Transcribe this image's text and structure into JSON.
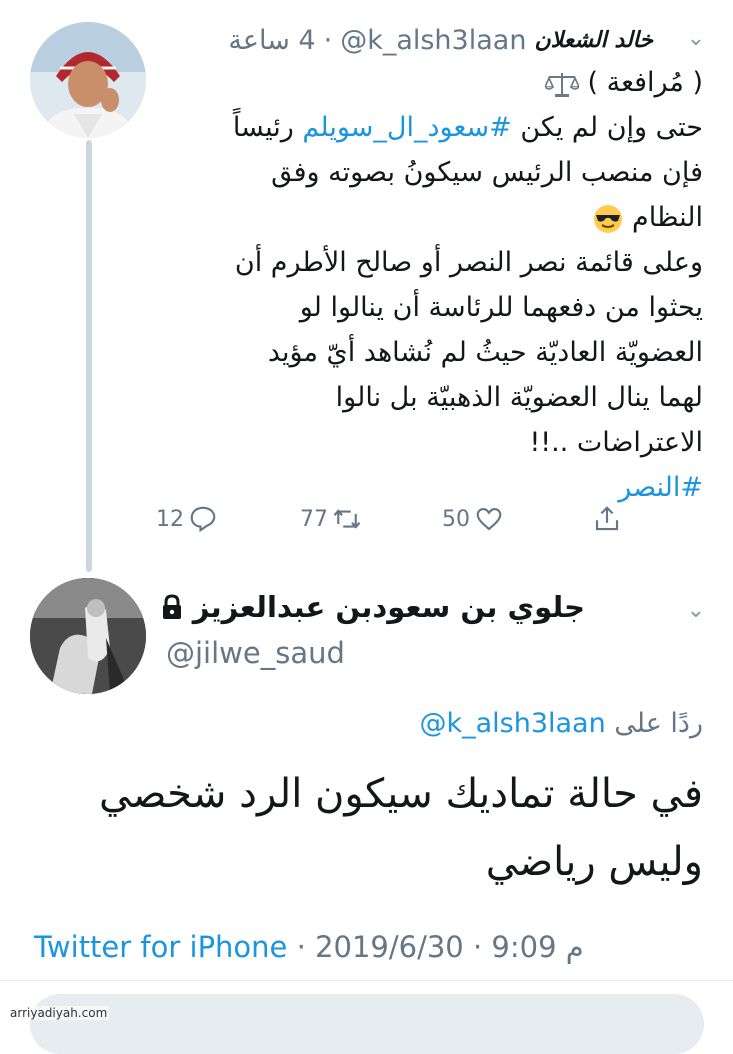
{
  "tweet1": {
    "author_name": "خالد الشعلان",
    "author_handle": "@k_alsh3laan",
    "time": "4 ساعة",
    "separator": "·",
    "body_lines": [
      "( مُرافعة )",
      "حتى وإن لم يكن #سعود_ال_سويلم رئيساً",
      "فإن منصب الرئيس سيكونُ بصوته وفق",
      "النظام",
      "وعلى قائمة نصر النصر أو صالح الأطرم أن",
      "يحثوا من دفعهما للرئاسة أن ينالوا لو",
      "العضويّة العاديّة حيثُ لم نُشاهد أيّ مؤيد",
      "لهما ينال العضويّة الذهبيّة بل نالوا",
      "الاعتراضات ..!!",
      "#النصر"
    ],
    "inline_prefix": "حتى وإن لم يكن ",
    "inline_hashtag": "#سعود_ال_سويلم",
    "inline_suffix": " رئيساً",
    "replies": "12",
    "retweets": "77",
    "likes": "50",
    "icons": {
      "scale": "scale-icon",
      "emoji": "sunglasses-emoji-icon",
      "reply": "reply-icon",
      "retweet": "retweet-icon",
      "like": "heart-icon",
      "share": "share-icon",
      "menu": "chevron-down-icon"
    }
  },
  "tweet2": {
    "author_name": "جلوي بن سعودبن عبدالعزيز",
    "author_handle": "@jilwe_saud",
    "reply_label": "ردًا على",
    "reply_mention": "@k_alsh3laan",
    "body_lines": [
      "في حالة تماديك سيكون الرد شخصي",
      "وليس رياضي"
    ],
    "source": "Twitter for iPhone",
    "date": "2019/6/30",
    "time": "9:09 م",
    "icons": {
      "lock": "lock-icon",
      "menu": "chevron-down-icon"
    }
  },
  "watermark": "arriyadiyah.com",
  "colors": {
    "link": "#1b95e0",
    "secondary": "#657786",
    "text": "#14171a",
    "thread": "#ccd6dd"
  }
}
